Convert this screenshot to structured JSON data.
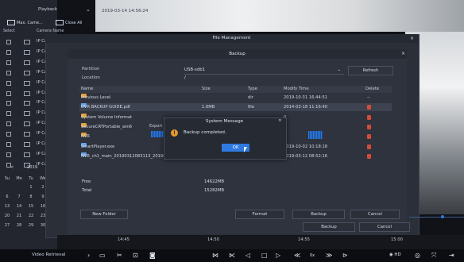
{
  "sidebar": {
    "header": "Playback",
    "max_camera_btn": "Max. Came...",
    "close_all_btn": "Close All",
    "col_select": "Select",
    "col_camera_name": "Camera Name",
    "cameras": [
      "IP Came",
      "IP Came",
      "IP Came",
      "IP Came",
      "IP Came",
      "IP Came",
      "IP Came",
      "IP Came",
      "IP Came",
      "IP Came",
      "IP Came",
      "IP Came",
      "IP Came"
    ],
    "calendar": {
      "prev": "<",
      "year": "2019",
      "weekdays": [
        "Su",
        "Mo",
        "Tu",
        "We"
      ],
      "rows": [
        [
          "",
          "",
          "1",
          "2"
        ],
        [
          "6",
          "7",
          "8",
          "9"
        ],
        [
          "13",
          "14",
          "15",
          "16"
        ],
        [
          "20",
          "21",
          "22",
          "23"
        ],
        [
          "27",
          "28",
          "29",
          "30"
        ]
      ]
    }
  },
  "video": {
    "timestamp": "2019-03-14 14:56:24"
  },
  "file_management": {
    "title": "File Management",
    "close": "×"
  },
  "backup": {
    "title": "Backup",
    "close": "×",
    "partition_label": "Partition",
    "partition_value": "USB-sdb1",
    "partition_chevron": "⌄",
    "location_label": "Location",
    "location_value": "/",
    "refresh_label": "Refresh",
    "columns": {
      "name": "Name",
      "size": "Size",
      "type": "Type",
      "modify_time": "Modify Time",
      "delete": "Delete"
    },
    "files": [
      {
        "name": "Previous Level",
        "size": "",
        "type": "dir",
        "time": "2019-10-31 16:44:51",
        "delete": "--",
        "icon": "folder-icon"
      },
      {
        "name": "DVR BACKUP GUIDE.pdf",
        "size": "1.6MB",
        "type": "file",
        "time": "2014-03-18 11:16:40",
        "delete": "trash",
        "icon": "document-icon"
      },
      {
        "name": "System Volume Informat",
        "size": "",
        "type": "",
        "time": "0",
        "delete": "trash",
        "icon": "folder-icon"
      },
      {
        "name": "SecureCRTPortable_win6",
        "size": "",
        "type": "",
        "time": "2",
        "delete": "trash",
        "icon": "folder-icon"
      },
      {
        "name": "NVR",
        "size": "",
        "type": "",
        "time": "4",
        "delete": "trash",
        "icon": "folder-icon"
      },
      {
        "name": "SmartPlayer.exe",
        "size": "2.7MB",
        "type": "file",
        "time": "2019-10-02 10:18:18",
        "delete": "trash",
        "icon": "document-icon"
      },
      {
        "name": "NVR_ch1_main_20190312083113_20190312083112...",
        "size": "1015.0KB",
        "type": "file",
        "time": "2019-03-12 08:52:16",
        "delete": "trash",
        "icon": "document-icon"
      }
    ],
    "free_label": "Free",
    "free_value": "14622MB",
    "total_label": "Total",
    "total_value": "15282MB",
    "new_folder_btn": "New Folder",
    "format_btn": "Format",
    "backup_btn": "Backup",
    "cancel_btn": "Cancel"
  },
  "outer_footer": {
    "backup_btn": "Backup",
    "cancel_btn": "Cancel"
  },
  "export_dialog": {
    "label": "Export"
  },
  "system_message": {
    "title": "System Message",
    "close": "×",
    "icon": "warning-icon",
    "message": "Backup completed.",
    "ok_label": "OK"
  },
  "timeline": {
    "ticks": [
      "14:45",
      "14:50",
      "14:55",
      "15:00"
    ]
  },
  "toolbar": {
    "title": "Video Retrieval",
    "hd_label": "HD"
  }
}
